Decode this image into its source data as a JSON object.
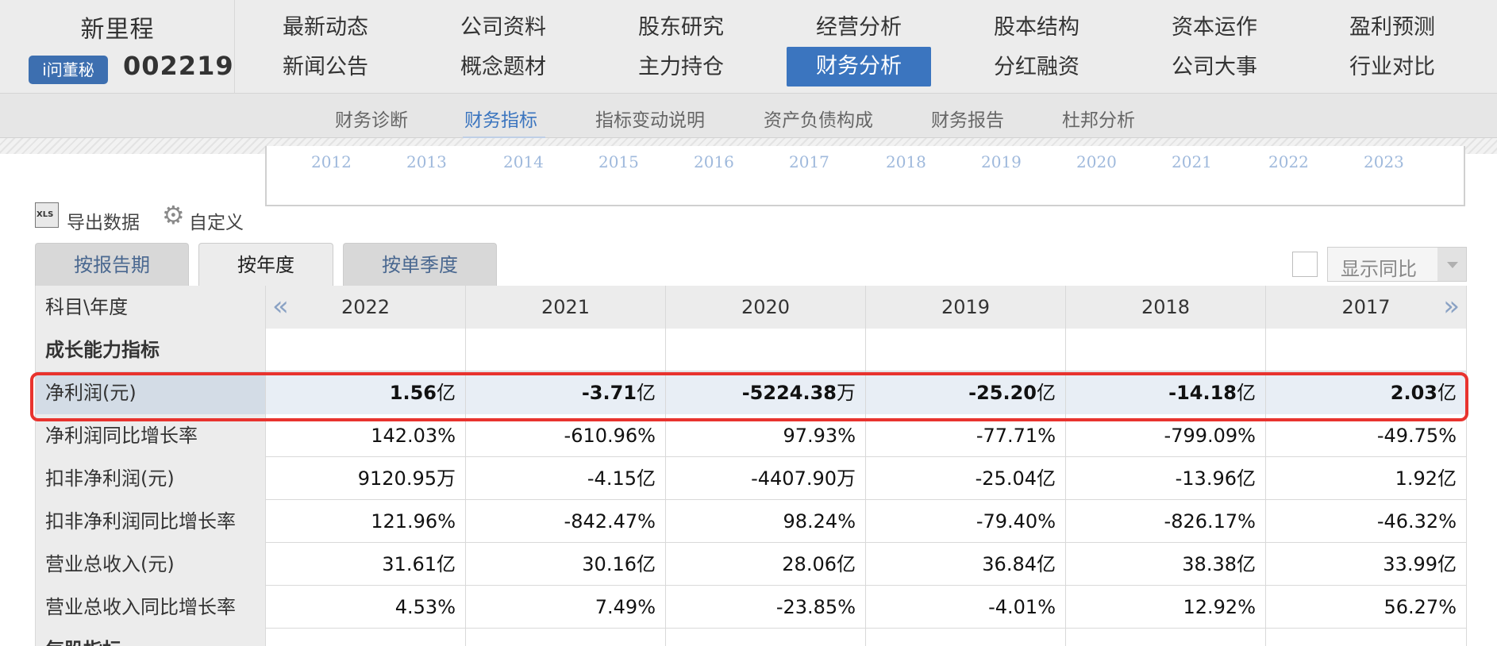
{
  "brand": {
    "name": "新里程",
    "badge": "i问董秘",
    "code": "002219"
  },
  "nav": {
    "row1": [
      "最新动态",
      "公司资料",
      "股东研究",
      "经营分析",
      "股本结构",
      "资本运作",
      "盈利预测"
    ],
    "row2": [
      "新闻公告",
      "概念题材",
      "主力持仓",
      "财务分析",
      "分红融资",
      "公司大事",
      "行业对比"
    ]
  },
  "subnav": [
    "财务诊断",
    "财务指标",
    "指标变动说明",
    "资产负债构成",
    "财务报告",
    "杜邦分析"
  ],
  "years": [
    "2012",
    "2013",
    "2014",
    "2015",
    "2016",
    "2017",
    "2018",
    "2019",
    "2020",
    "2021",
    "2022",
    "2023"
  ],
  "toolbar": {
    "export": "导出数据",
    "custom": "自定义"
  },
  "tabs": [
    "按报告期",
    "按年度",
    "按单季度"
  ],
  "yoy": {
    "label": "显示同比"
  },
  "table": {
    "corner": "科目\\年度",
    "columns": [
      "2022",
      "2021",
      "2020",
      "2019",
      "2018",
      "2017"
    ],
    "section": "成长能力指标",
    "rows": [
      {
        "label": "净利润(元)",
        "cells": [
          [
            "1.56",
            "亿"
          ],
          [
            "-3.71",
            "亿"
          ],
          [
            "-5224.38",
            "万"
          ],
          [
            "-25.20",
            "亿"
          ],
          [
            "-14.18",
            "亿"
          ],
          [
            "2.03",
            "亿"
          ]
        ]
      },
      {
        "label": "净利润同比增长率",
        "cells": [
          [
            "142.03%",
            ""
          ],
          [
            "-610.96%",
            ""
          ],
          [
            "97.93%",
            ""
          ],
          [
            "-77.71%",
            ""
          ],
          [
            "-799.09%",
            ""
          ],
          [
            "-49.75%",
            ""
          ]
        ]
      },
      {
        "label": "扣非净利润(元)",
        "cells": [
          [
            "9120.95",
            "万"
          ],
          [
            "-4.15",
            "亿"
          ],
          [
            "-4407.90",
            "万"
          ],
          [
            "-25.04",
            "亿"
          ],
          [
            "-13.96",
            "亿"
          ],
          [
            "1.92",
            "亿"
          ]
        ]
      },
      {
        "label": "扣非净利润同比增长率",
        "cells": [
          [
            "121.96%",
            ""
          ],
          [
            "-842.47%",
            ""
          ],
          [
            "98.24%",
            ""
          ],
          [
            "-79.40%",
            ""
          ],
          [
            "-826.17%",
            ""
          ],
          [
            "-46.32%",
            ""
          ]
        ]
      },
      {
        "label": "营业总收入(元)",
        "cells": [
          [
            "31.61",
            "亿"
          ],
          [
            "30.16",
            "亿"
          ],
          [
            "28.06",
            "亿"
          ],
          [
            "36.84",
            "亿"
          ],
          [
            "38.38",
            "亿"
          ],
          [
            "33.99",
            "亿"
          ]
        ]
      },
      {
        "label": "营业总收入同比增长率",
        "cells": [
          [
            "4.53%",
            ""
          ],
          [
            "7.49%",
            ""
          ],
          [
            "-23.85%",
            ""
          ],
          [
            "-4.01%",
            ""
          ],
          [
            "12.92%",
            ""
          ],
          [
            "56.27%",
            ""
          ]
        ]
      }
    ],
    "partial_row": "每股指标"
  },
  "colors": {
    "accent": "#3b75bf",
    "highlight_frame": "#e8332e"
  }
}
